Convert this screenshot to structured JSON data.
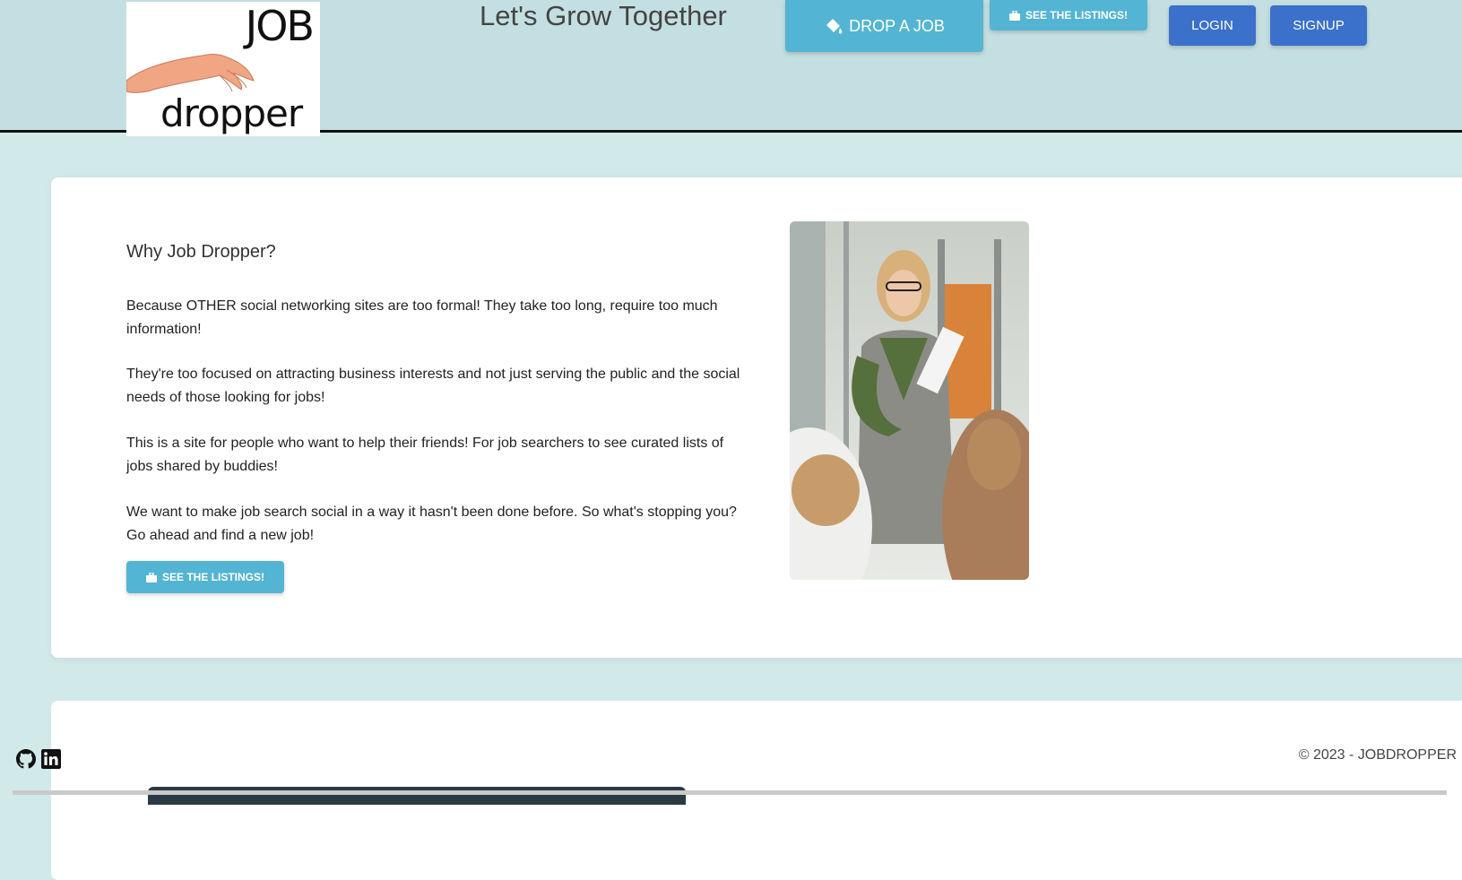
{
  "header": {
    "logo": {
      "top_text": "JOB",
      "bottom_text": "dropper"
    },
    "tagline": "Let's Grow Together",
    "drop_job_label": "DROP A JOB",
    "see_listings_label": "SEE THE LISTINGS!",
    "login_label": "LOGIN",
    "signup_label": "SIGNUP"
  },
  "main": {
    "title": "Why Job Dropper?",
    "paragraphs": [
      "Because OTHER social networking sites are too formal! They take too long, require too much information!",
      "They're too focused on attracting business interests and not just serving the public and the social needs of those looking for jobs!",
      "This is a site for people who want to help their friends! For job searchers to see curated lists of jobs shared by buddies!",
      "We want to make job search social in a way it hasn't been done before. So what's stopping you? Go ahead and find a new job!"
    ],
    "see_listings_label": "SEE THE LISTINGS!"
  },
  "footer": {
    "icons": [
      "github-icon",
      "linkedin-icon"
    ],
    "copyright": "© 2023 - JOBDROPPER"
  },
  "colors": {
    "header_bg": "#c4dfe1",
    "page_bg": "#d2e9ea",
    "info_button": "#54b4d3",
    "primary_button": "#3b71ca"
  }
}
